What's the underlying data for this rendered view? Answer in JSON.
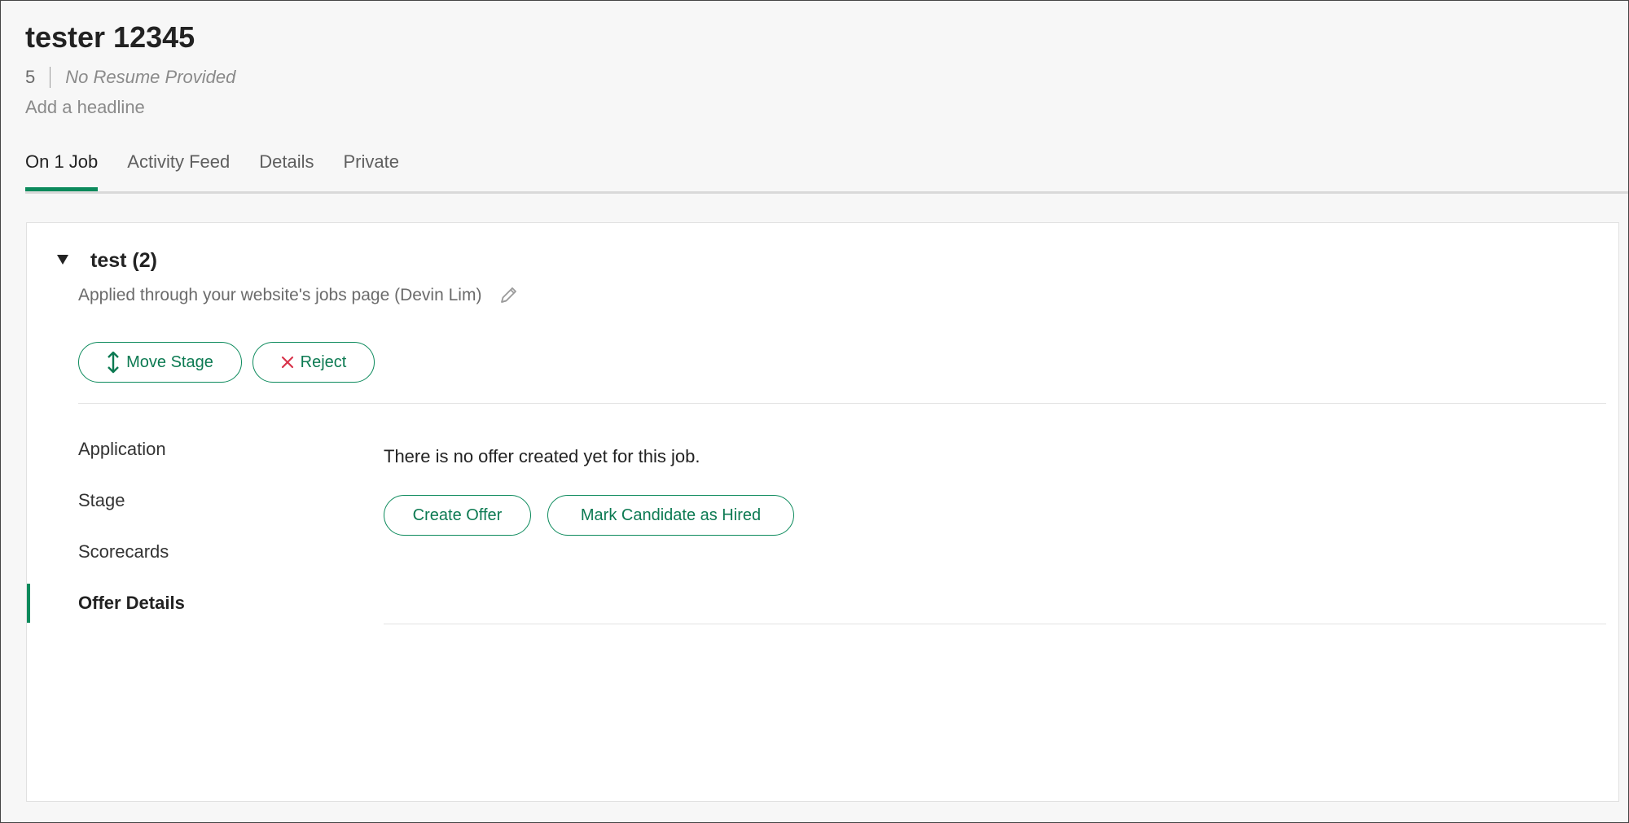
{
  "candidate": {
    "name": "tester 12345",
    "id_number": "5",
    "resume_status": "No Resume Provided",
    "headline_placeholder": "Add a headline"
  },
  "tabs": [
    {
      "label": "On 1 Job",
      "active": true
    },
    {
      "label": "Activity Feed",
      "active": false
    },
    {
      "label": "Details",
      "active": false
    },
    {
      "label": "Private",
      "active": false
    }
  ],
  "job": {
    "title": "test (2)",
    "source": "Applied through your website's jobs page (Devin Lim)",
    "move_stage_label": "Move Stage",
    "reject_label": "Reject"
  },
  "side_nav": [
    {
      "label": "Application",
      "active": false
    },
    {
      "label": "Stage",
      "active": false
    },
    {
      "label": "Scorecards",
      "active": false
    },
    {
      "label": "Offer Details",
      "active": true
    }
  ],
  "offer": {
    "message": "There is no offer created yet for this job.",
    "create_label": "Create Offer",
    "hired_label": "Mark Candidate as Hired"
  },
  "colors": {
    "accent": "#0c8a5c",
    "reject_icon": "#d8344b",
    "background": "#f7f7f7"
  },
  "icons": {
    "caret": "caret-down-icon",
    "edit": "pencil-icon",
    "move": "vertical-arrows-icon",
    "reject": "close-icon"
  }
}
